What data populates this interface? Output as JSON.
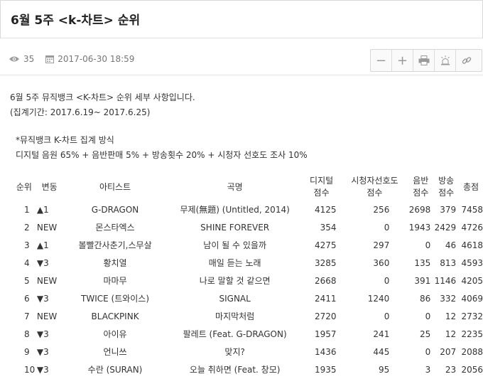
{
  "post": {
    "title": "6월 5주 <k-차트> 순위",
    "views": "35",
    "datetime": "2017-06-30 18:59"
  },
  "icons": {
    "views": "eye-icon",
    "date": "calendar-icon",
    "tools": [
      "zoom-out-icon",
      "zoom-in-icon",
      "print-icon",
      "report-icon",
      "link-icon"
    ]
  },
  "toolbar": {
    "zoom_out": "−",
    "zoom_in": "+"
  },
  "content": {
    "line1": "6월 5주 뮤직뱅크 <K-차트> 순위 세부 사항입니다.",
    "line2": "(집계기간: 2017.6.19~ 2017.6.25)",
    "line3": "*뮤직뱅크 K-차트 집계 방식",
    "line4": "디지털 음원 65% + 음반판매 5% + 방송횟수 20% + 시청자 선호도 조사 10%"
  },
  "table": {
    "headers": [
      "순위",
      "변동",
      "아티스트",
      "곡명",
      "디지털\n점수",
      "시청자선호도\n점수",
      "음반\n점수",
      "방송\n점수",
      "총점"
    ],
    "rows": [
      [
        "1",
        "▲1",
        "G-DRAGON",
        "무제(無題) (Untitled, 2014)",
        "4125",
        "256",
        "2698",
        "379",
        "7458"
      ],
      [
        "2",
        "NEW",
        "몬스타엑스",
        "SHINE FOREVER",
        "354",
        "0",
        "1943",
        "2429",
        "4726"
      ],
      [
        "3",
        "▲1",
        "볼빨간사춘기,스무살",
        "남이 될 수 있을까",
        "4275",
        "297",
        "0",
        "46",
        "4618"
      ],
      [
        "4",
        "▼3",
        "황치열",
        "매일 듣는 노래",
        "3285",
        "360",
        "135",
        "813",
        "4593"
      ],
      [
        "5",
        "NEW",
        "마마무",
        "나로 말할 것 같으면",
        "2668",
        "0",
        "391",
        "1146",
        "4205"
      ],
      [
        "6",
        "▼3",
        "TWICE (트와이스)",
        "SIGNAL",
        "2411",
        "1240",
        "86",
        "332",
        "4069"
      ],
      [
        "7",
        "NEW",
        "BLACKPINK",
        "마지막처럼",
        "2720",
        "0",
        "0",
        "12",
        "2732"
      ],
      [
        "8",
        "▼3",
        "아이유",
        "팔레트 (Feat. G-DRAGON)",
        "1957",
        "241",
        "25",
        "12",
        "2235"
      ],
      [
        "9",
        "▼3",
        "언니쓰",
        "맞지?",
        "1436",
        "445",
        "0",
        "207",
        "2088"
      ],
      [
        "10",
        "▼3",
        "수란 (SURAN)",
        "오늘 취하면 (Feat. 창모)",
        "1935",
        "95",
        "3",
        "23",
        "2056"
      ]
    ]
  }
}
